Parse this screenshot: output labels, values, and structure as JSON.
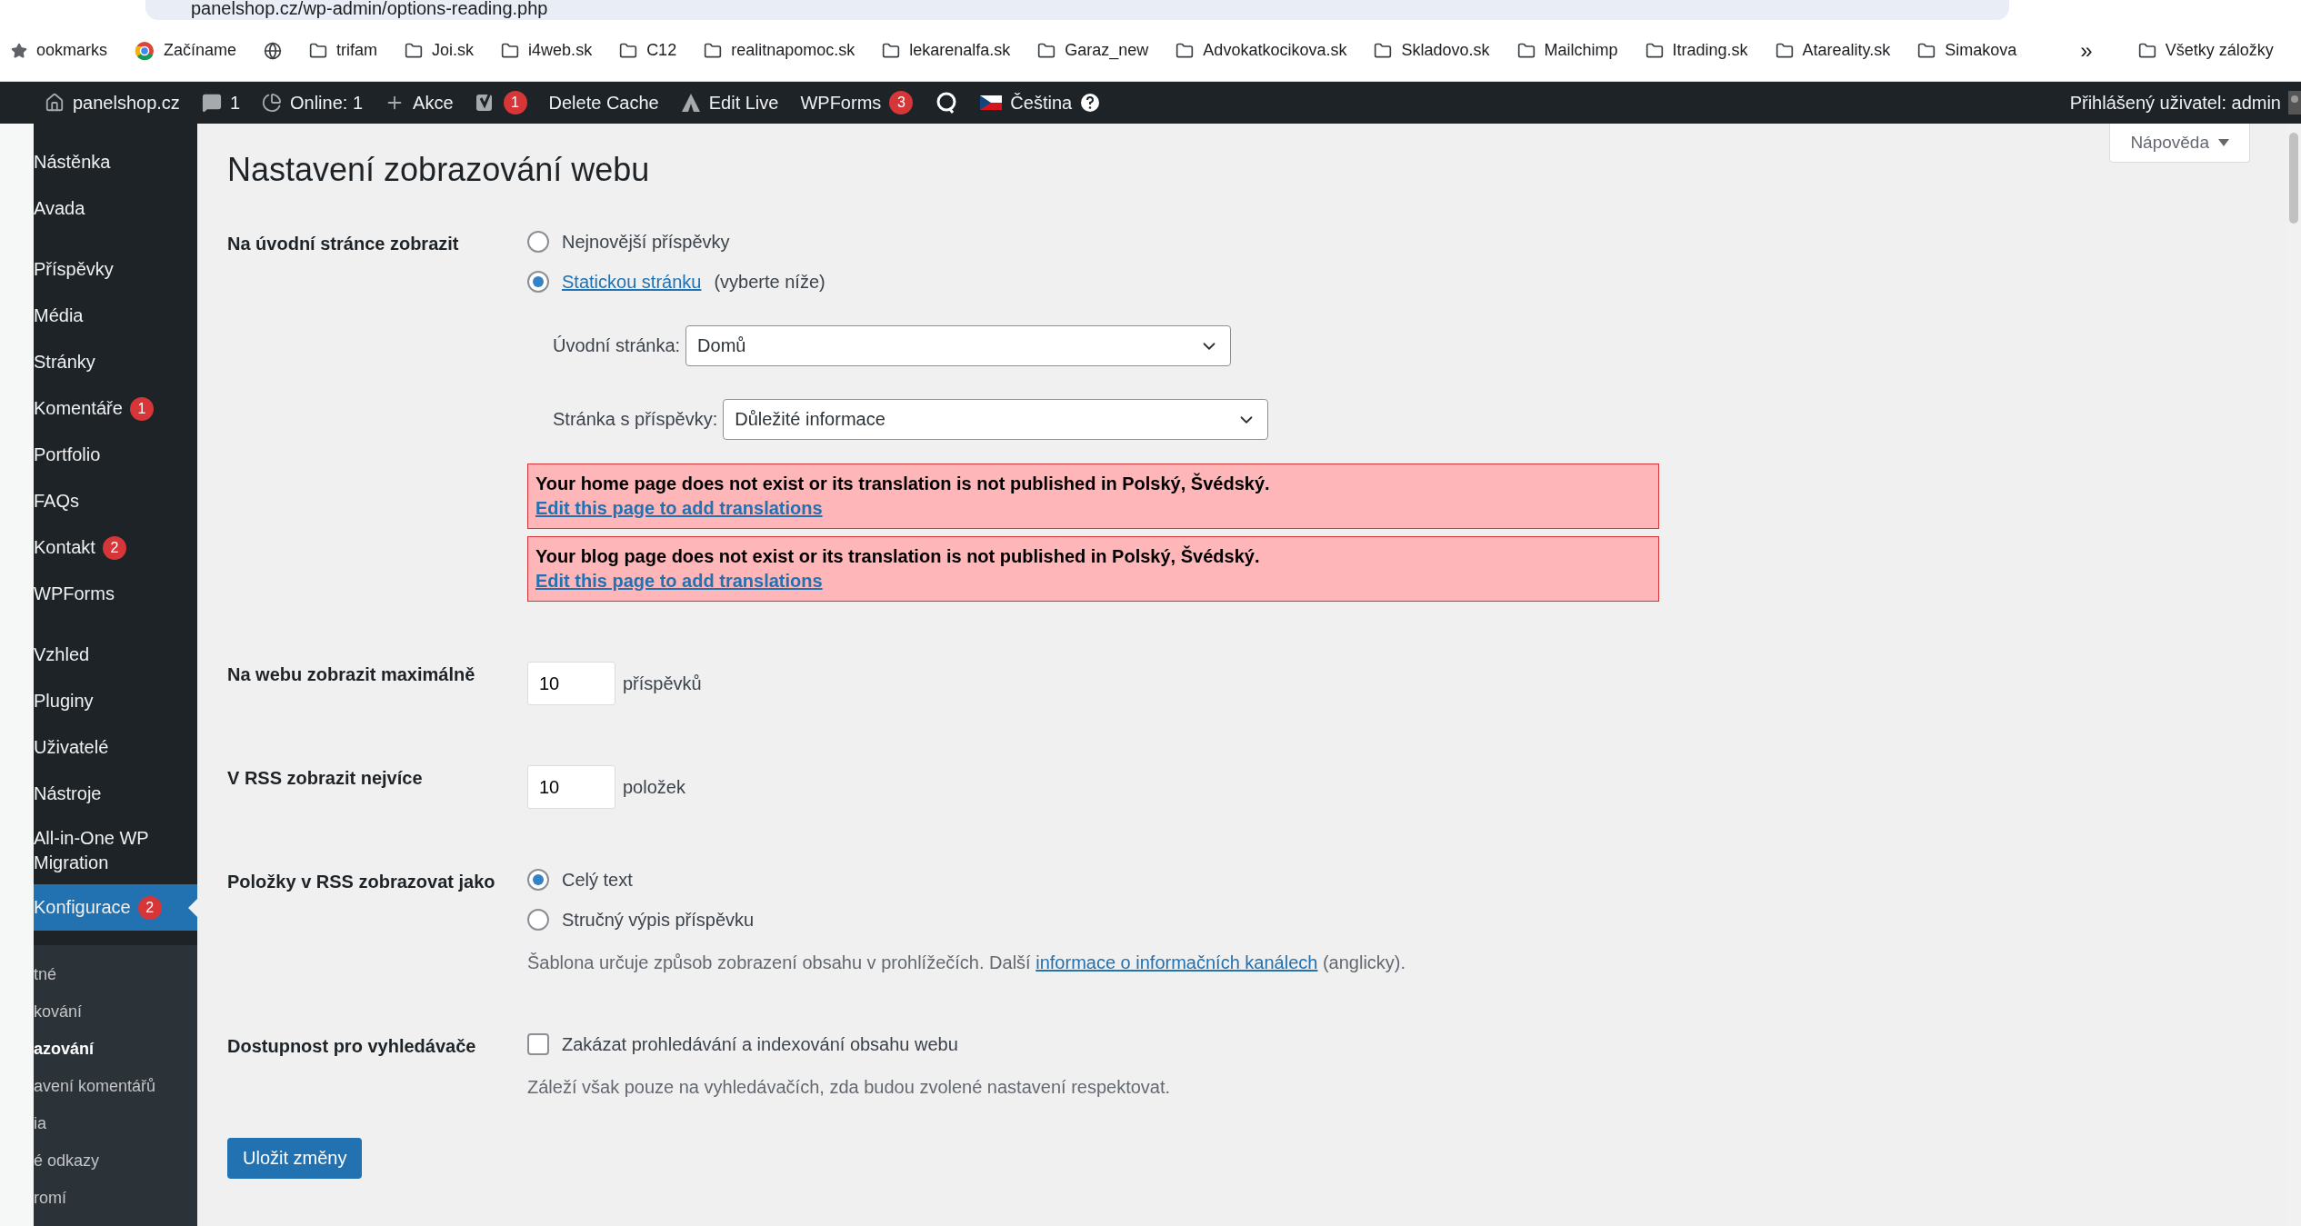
{
  "browser": {
    "url": "panelshop.cz/wp-admin/options-reading.php",
    "bookmarks_label": "ookmarks",
    "bookmarks": [
      {
        "kind": "chrome",
        "label": "Začíname"
      },
      {
        "kind": "globe"
      },
      {
        "kind": "folder",
        "label": "trifam"
      },
      {
        "kind": "folder",
        "label": "Joi.sk"
      },
      {
        "kind": "folder",
        "label": "i4web.sk"
      },
      {
        "kind": "folder",
        "label": "C12"
      },
      {
        "kind": "folder",
        "label": "realitnapomoc.sk"
      },
      {
        "kind": "folder",
        "label": "lekarenalfa.sk"
      },
      {
        "kind": "folder",
        "label": "Garaz_new"
      },
      {
        "kind": "folder",
        "label": "Advokatkocikova.sk"
      },
      {
        "kind": "folder",
        "label": "Skladovo.sk"
      },
      {
        "kind": "folder",
        "label": "Mailchimp"
      },
      {
        "kind": "folder",
        "label": "Itrading.sk"
      },
      {
        "kind": "folder",
        "label": "Atareality.sk"
      },
      {
        "kind": "folder",
        "label": "Simakova"
      }
    ],
    "overflow": "»",
    "all_bookmarks": "Všetky záložky"
  },
  "admin_bar": {
    "items": [
      {
        "kind": "home",
        "label": "panelshop.cz"
      },
      {
        "kind": "comments",
        "label": "1"
      },
      {
        "kind": "online",
        "label": "Online: 1"
      },
      {
        "kind": "new",
        "label": "Akce"
      },
      {
        "kind": "seo",
        "badge": "1"
      },
      {
        "kind": "text",
        "label": "Delete Cache"
      },
      {
        "kind": "live",
        "label": "Edit Live"
      },
      {
        "kind": "text",
        "label": "WPForms",
        "badge": "3"
      },
      {
        "kind": "loop"
      },
      {
        "kind": "language",
        "label": "Čeština"
      }
    ],
    "user": "Přihlášený uživatel: admin"
  },
  "sidebar": {
    "groups": [
      [
        {
          "label": "Nástěnka",
          "selected": false
        },
        {
          "label": "Avada",
          "selected": false
        }
      ],
      [
        {
          "label": "Příspěvky",
          "selected": false
        },
        {
          "label": "Média",
          "selected": false
        },
        {
          "label": "Stránky",
          "selected": false
        },
        {
          "label": "Komentáře",
          "badge": "1",
          "selected": false
        },
        {
          "label": "Portfolio",
          "selected": false
        },
        {
          "label": "FAQs",
          "selected": false
        },
        {
          "label": "Kontakt",
          "badge": "2",
          "selected": false
        },
        {
          "label": "WPForms",
          "selected": false
        }
      ],
      [
        {
          "label": "Vzhled",
          "selected": false
        },
        {
          "label": "Pluginy",
          "selected": false
        },
        {
          "label": "Uživatelé",
          "selected": false
        },
        {
          "label": "Nástroje",
          "selected": false
        },
        {
          "label": "All-in-One WP Migration",
          "selected": false
        },
        {
          "label": "Konfigurace",
          "badge": "2",
          "selected": true
        }
      ]
    ],
    "submenu": [
      {
        "label": "tné",
        "selected": false
      },
      {
        "label": "kování",
        "selected": false
      },
      {
        "label": "azování",
        "selected": true
      },
      {
        "label": "avení komentářů",
        "selected": false
      },
      {
        "label": "ia",
        "selected": false
      },
      {
        "label": "é odkazy",
        "selected": false
      },
      {
        "label": "romí",
        "selected": false
      }
    ]
  },
  "help_tab": "Nápověda",
  "page": {
    "title": "Nastavení zobrazování webu",
    "rows": [
      {
        "kind": "front",
        "label": "Na úvodní stránce zobrazit",
        "options": [
          {
            "label": "Nejnovější příspěvky",
            "selected": false
          },
          {
            "link": "Statickou stránku",
            "label": "(vyberte níže)",
            "selected": true
          }
        ],
        "selects": [
          {
            "label": "Úvodní stránka:",
            "value": "Domů"
          },
          {
            "label": "Stránka s příspěvky:",
            "value": "Důležité informace"
          }
        ],
        "alerts": [
          {
            "text": "Your home page does not exist or its translation is not published in Polský, Švédský.",
            "link": "Edit this page to add translations"
          },
          {
            "text": "Your blog page does not exist or its translation is not published in Polský, Švédský.",
            "link": "Edit this page to add translations"
          }
        ]
      },
      {
        "kind": "number",
        "label": "Na webu zobrazit maximálně",
        "value": "10",
        "unit": "příspěvků"
      },
      {
        "kind": "number",
        "label": "V RSS zobrazit nejvíce",
        "value": "10",
        "unit": "položek"
      },
      {
        "kind": "radios",
        "label": "Položky v RSS zobrazovat jako",
        "options": [
          {
            "label": "Celý text",
            "selected": true
          },
          {
            "label": "Stručný výpis příspěvku",
            "selected": false
          }
        ],
        "description": {
          "before": "Šablona určuje způsob zobrazení obsahu v prohlížečích. Další",
          "link": "informace o informačních kanálech",
          "after": "(anglicky)."
        }
      },
      {
        "kind": "checkbox",
        "label": "Dostupnost pro vyhledávače",
        "checkbox_label": "Zakázat prohledávání a indexování obsahu webu",
        "checked": false,
        "description": {
          "before": "Záleží však pouze na vyhledávačích, zda budou zvolené nastavení respektovat."
        }
      }
    ],
    "submit": "Uložit změny"
  }
}
